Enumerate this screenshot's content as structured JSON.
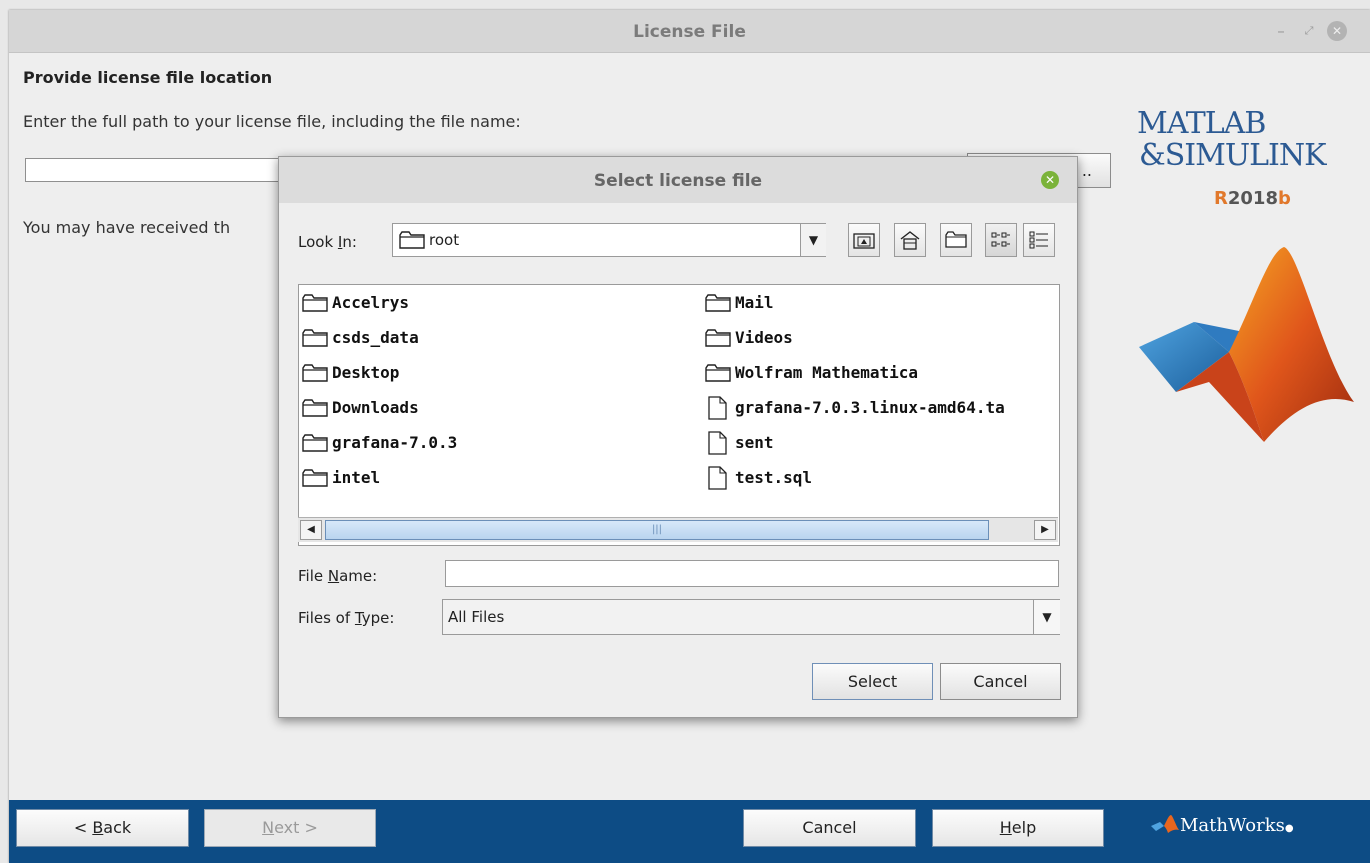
{
  "window": {
    "title": "License File",
    "minimize": "–",
    "restore": "⤢",
    "close": "✕"
  },
  "page": {
    "heading": "Provide license file location",
    "instruction": "Enter the full path to your license file, including the file name:",
    "path_value": "",
    "browse_label": "..",
    "note": "You may have received th"
  },
  "logo": {
    "line1": "MATLAB",
    "line2": "&SIMULINK",
    "release_prefix": "R",
    "release_year": "2018",
    "release_suffix": "b",
    "company": "MathWorks"
  },
  "footer": {
    "back_prefix": "< ",
    "back_key": "B",
    "back_rest": "ack",
    "next_key": "N",
    "next_rest": "ext >",
    "cancel": "Cancel",
    "help_key": "H",
    "help_rest": "elp"
  },
  "dialog": {
    "title": "Select license file",
    "look_in_prefix": "Look ",
    "look_in_key": "I",
    "look_in_rest": "n:",
    "look_in_value": "root",
    "files_col1": [
      {
        "name": "Accelrys",
        "icon": "folder-icon"
      },
      {
        "name": "csds_data",
        "icon": "folder-icon"
      },
      {
        "name": "Desktop",
        "icon": "folder-icon"
      },
      {
        "name": "Downloads",
        "icon": "folder-icon"
      },
      {
        "name": "grafana-7.0.3",
        "icon": "folder-icon"
      },
      {
        "name": "intel",
        "icon": "folder-icon"
      }
    ],
    "files_col2": [
      {
        "name": "Mail",
        "icon": "folder-icon"
      },
      {
        "name": "Videos",
        "icon": "folder-icon"
      },
      {
        "name": "Wolfram Mathematica",
        "icon": "folder-icon"
      },
      {
        "name": "grafana-7.0.3.linux-amd64.ta",
        "icon": "file-icon"
      },
      {
        "name": "sent",
        "icon": "file-icon"
      },
      {
        "name": "test.sql",
        "icon": "file-icon"
      }
    ],
    "file_name_prefix": "File ",
    "file_name_key": "N",
    "file_name_rest": "ame:",
    "file_name_value": "",
    "files_of_type_prefix": "Files of ",
    "files_of_type_key": "T",
    "files_of_type_rest": "ype:",
    "files_of_type_value": "All Files",
    "select_label": "Select",
    "cancel_label": "Cancel"
  }
}
